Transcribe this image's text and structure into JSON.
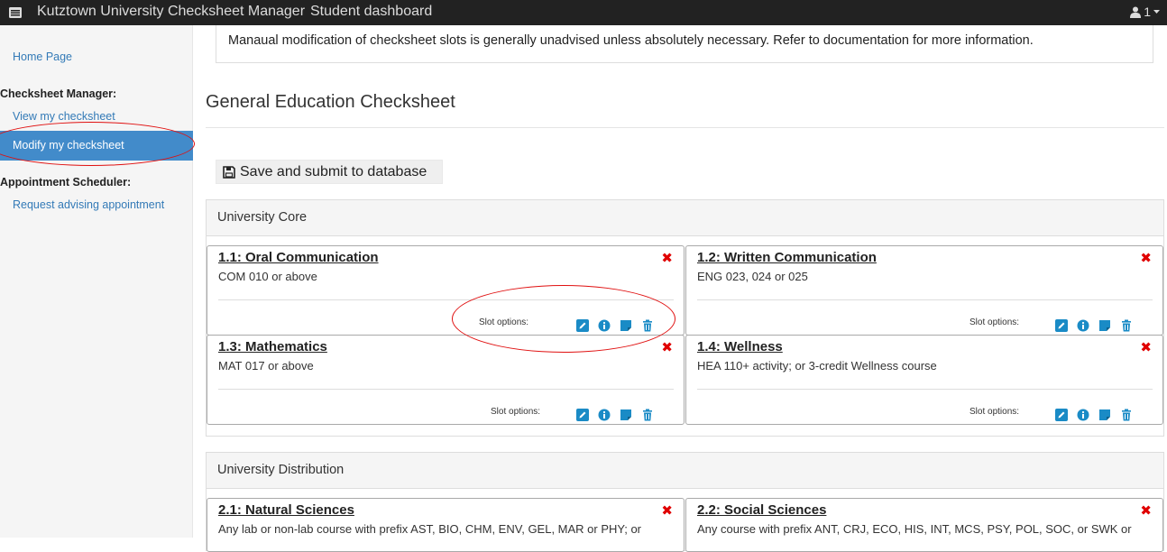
{
  "topbar": {
    "app_title": "Kutztown University Checksheet Manager",
    "page_title": "Student dashboard",
    "user_count": "1",
    "icons": {
      "menu": "menu-icon",
      "user": "user-icon",
      "caret": "caret-down-icon"
    }
  },
  "sidebar": {
    "home": "Home Page",
    "checksheet_heading": "Checksheet Manager:",
    "view": "View my checksheet",
    "modify": "Modify my checksheet",
    "appointment_heading": "Appointment Scheduler:",
    "request": "Request advising appointment"
  },
  "alert": {
    "text": "Manaual modification of checksheet slots is generally unadvised unless absolutely necessary. Refer to documentation for more information."
  },
  "main": {
    "title": "General Education Checksheet",
    "save_label": "Save and submit to database"
  },
  "panels": [
    {
      "heading": "University Core",
      "slots": [
        {
          "title": "1.1: Oral Communication",
          "desc": "COM 010 or above",
          "options_label": "Slot options:"
        },
        {
          "title": "1.2: Written Communication",
          "desc": "ENG 023, 024 or 025",
          "options_label": "Slot options:"
        },
        {
          "title": "1.3: Mathematics",
          "desc": "MAT 017 or above",
          "options_label": "Slot options:"
        },
        {
          "title": "1.4: Wellness",
          "desc": "HEA 110+ activity; or 3-credit Wellness course",
          "options_label": "Slot options:"
        }
      ]
    },
    {
      "heading": "University Distribution",
      "slots": [
        {
          "title": "2.1: Natural Sciences",
          "desc": "Any lab or non-lab course with prefix AST, BIO, CHM, ENV, GEL, MAR or PHY; or"
        },
        {
          "title": "2.2: Social Sciences",
          "desc": "Any course with prefix ANT, CRJ, ECO, HIS, INT, MCS, PSY, POL, SOC, or SWK or"
        }
      ]
    }
  ],
  "slot_icons": [
    "edit-icon",
    "info-icon",
    "note-icon",
    "trash-icon"
  ],
  "colors": {
    "accent": "#428bca",
    "link": "#337ab7",
    "icon": "#1a8bc6",
    "remove": "#e00000",
    "annotation": "#e01010"
  }
}
